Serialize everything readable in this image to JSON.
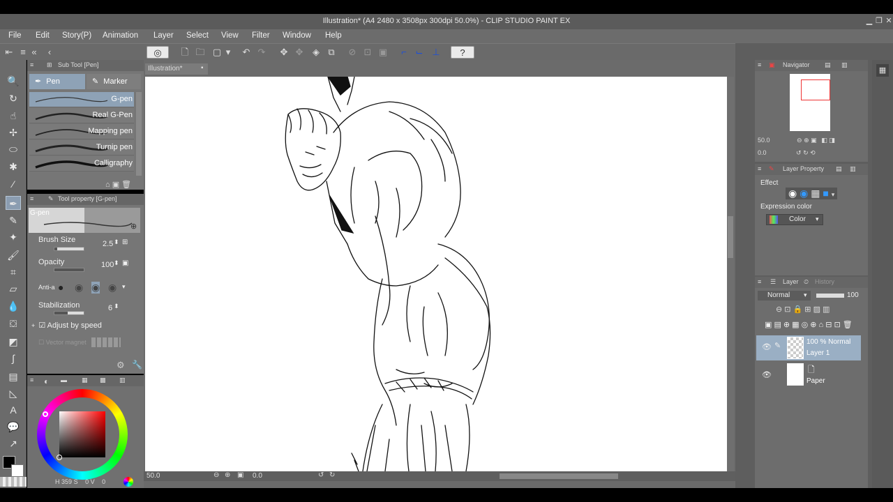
{
  "window": {
    "title": "Illustration* (A4 2480 x 3508px 300dpi 50.0%) - CLIP STUDIO PAINT EX"
  },
  "menu": [
    "File",
    "Edit",
    "Story(P)",
    "Animation",
    "Layer",
    "Select",
    "View",
    "Filter",
    "Window",
    "Help"
  ],
  "subtool": {
    "header": "Sub Tool [Pen]",
    "tabs": [
      "Pen",
      "Marker"
    ],
    "brushes": [
      "G-pen",
      "Real G-Pen",
      "Mapping pen",
      "Turnip pen",
      "Calligraphy"
    ]
  },
  "toolprop": {
    "header": "Tool property [G-pen]",
    "preview_label": "G-pen",
    "brush_size_label": "Brush Size",
    "brush_size_value": "2.5",
    "brush_size_fraction": 0.1,
    "opacity_label": "Opacity",
    "opacity_value": "100",
    "opacity_fraction": 1.0,
    "antialias_label": "Anti-a",
    "stabilization_label": "Stabilization",
    "stabilization_value": "6",
    "stabilization_fraction": 0.45,
    "adjust_label": "Adjust by speed",
    "vector_label": "Vector magnet"
  },
  "color": {
    "main": "#000000",
    "sub": "#ffffff",
    "hue_readout": "359",
    "s_label": "S",
    "s_value": "0",
    "v_label": "V",
    "v_value": "0"
  },
  "canvas": {
    "tab_label": "Illustration*",
    "zoom": "50.0",
    "angle": "0.0"
  },
  "navigator": {
    "header": "Navigator",
    "zoom": "50.0",
    "angle": "0.0"
  },
  "layer_property": {
    "header": "Layer Property",
    "effect_label": "Effect",
    "expression_label": "Expression color",
    "expression_value": "Color"
  },
  "layers": {
    "tab_label": "Layer",
    "history_label": "History",
    "blend_mode": "Normal",
    "opacity": "100",
    "items": [
      {
        "line1": "100 % Normal",
        "line2": "Layer 1"
      },
      {
        "line1": "",
        "line2": "Paper"
      }
    ]
  },
  "colors": {
    "accent": "#8ea2b6",
    "panel": "#767676",
    "canvas_bg": "#ffffff"
  }
}
